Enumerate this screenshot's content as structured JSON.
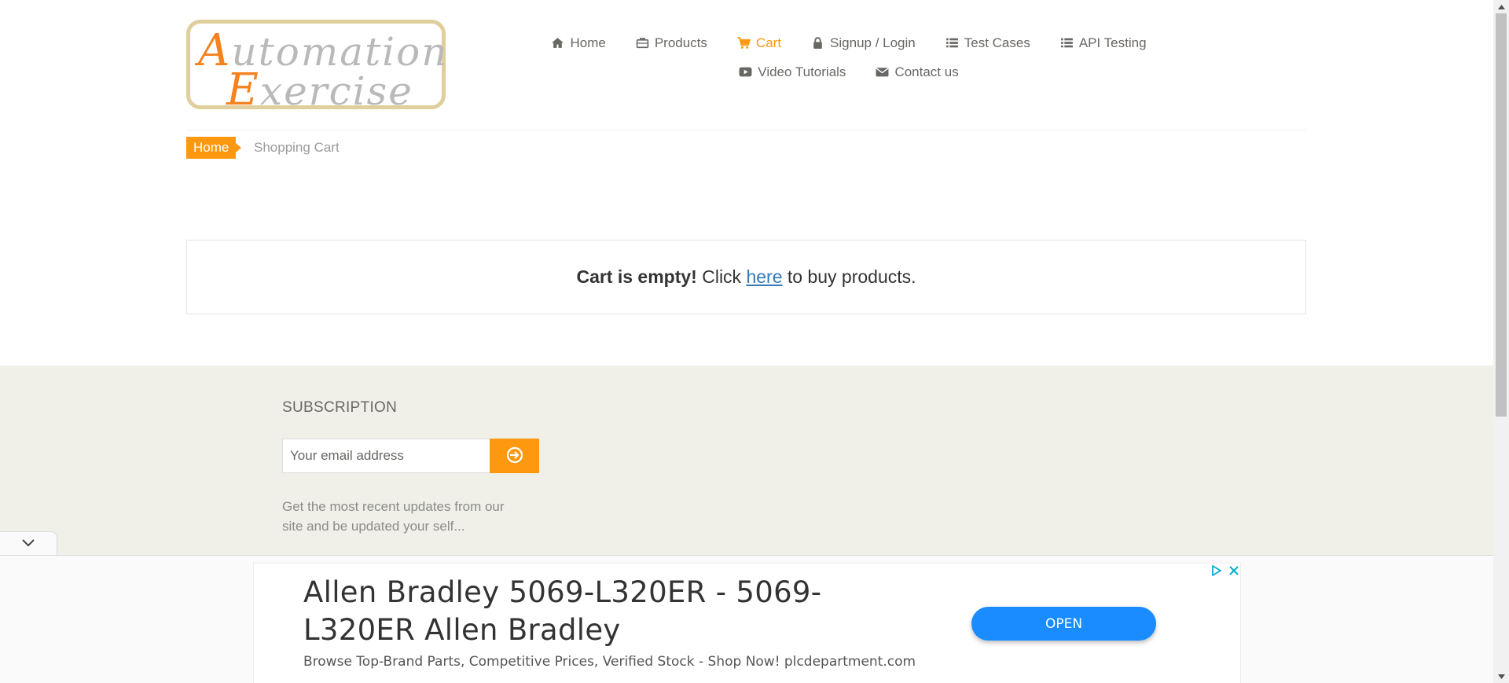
{
  "logo": {
    "line1_cap": "A",
    "line1_rest": "utomation",
    "line2_cap": "E",
    "line2_rest": "xercise"
  },
  "nav": {
    "row1": [
      {
        "id": "home",
        "label": "Home",
        "icon": "home-icon"
      },
      {
        "id": "products",
        "label": "Products",
        "icon": "briefcase-icon"
      },
      {
        "id": "cart",
        "label": "Cart",
        "icon": "cart-icon",
        "active": true
      },
      {
        "id": "login",
        "label": "Signup / Login",
        "icon": "lock-icon"
      },
      {
        "id": "test-cases",
        "label": "Test Cases",
        "icon": "list-icon"
      },
      {
        "id": "api-testing",
        "label": "API Testing",
        "icon": "list-icon"
      }
    ],
    "row2": [
      {
        "id": "video",
        "label": "Video Tutorials",
        "icon": "youtube-icon"
      },
      {
        "id": "contact",
        "label": "Contact us",
        "icon": "envelope-icon"
      }
    ]
  },
  "breadcrumb": {
    "home": "Home",
    "current": "Shopping Cart"
  },
  "cart": {
    "empty_bold": "Cart is empty!",
    "click": " Click ",
    "link": "here",
    "rest": " to buy products."
  },
  "subscription": {
    "title": "SUBSCRIPTION",
    "placeholder": "Your email address",
    "text": "Get the most recent updates from our site and be updated your self..."
  },
  "ad": {
    "title": "Allen Bradley 5069-L320ER - 5069-L320ER Allen Bradley",
    "description": "Browse Top-Brand Parts, Competitive Prices, Verified Stock - Shop Now! plcdepartment.com",
    "button": "OPEN"
  },
  "colors": {
    "accent": "#fe980f",
    "footer_bg": "#f0f0e9",
    "link": "#337ab7",
    "ad_button": "#1a8cff"
  }
}
